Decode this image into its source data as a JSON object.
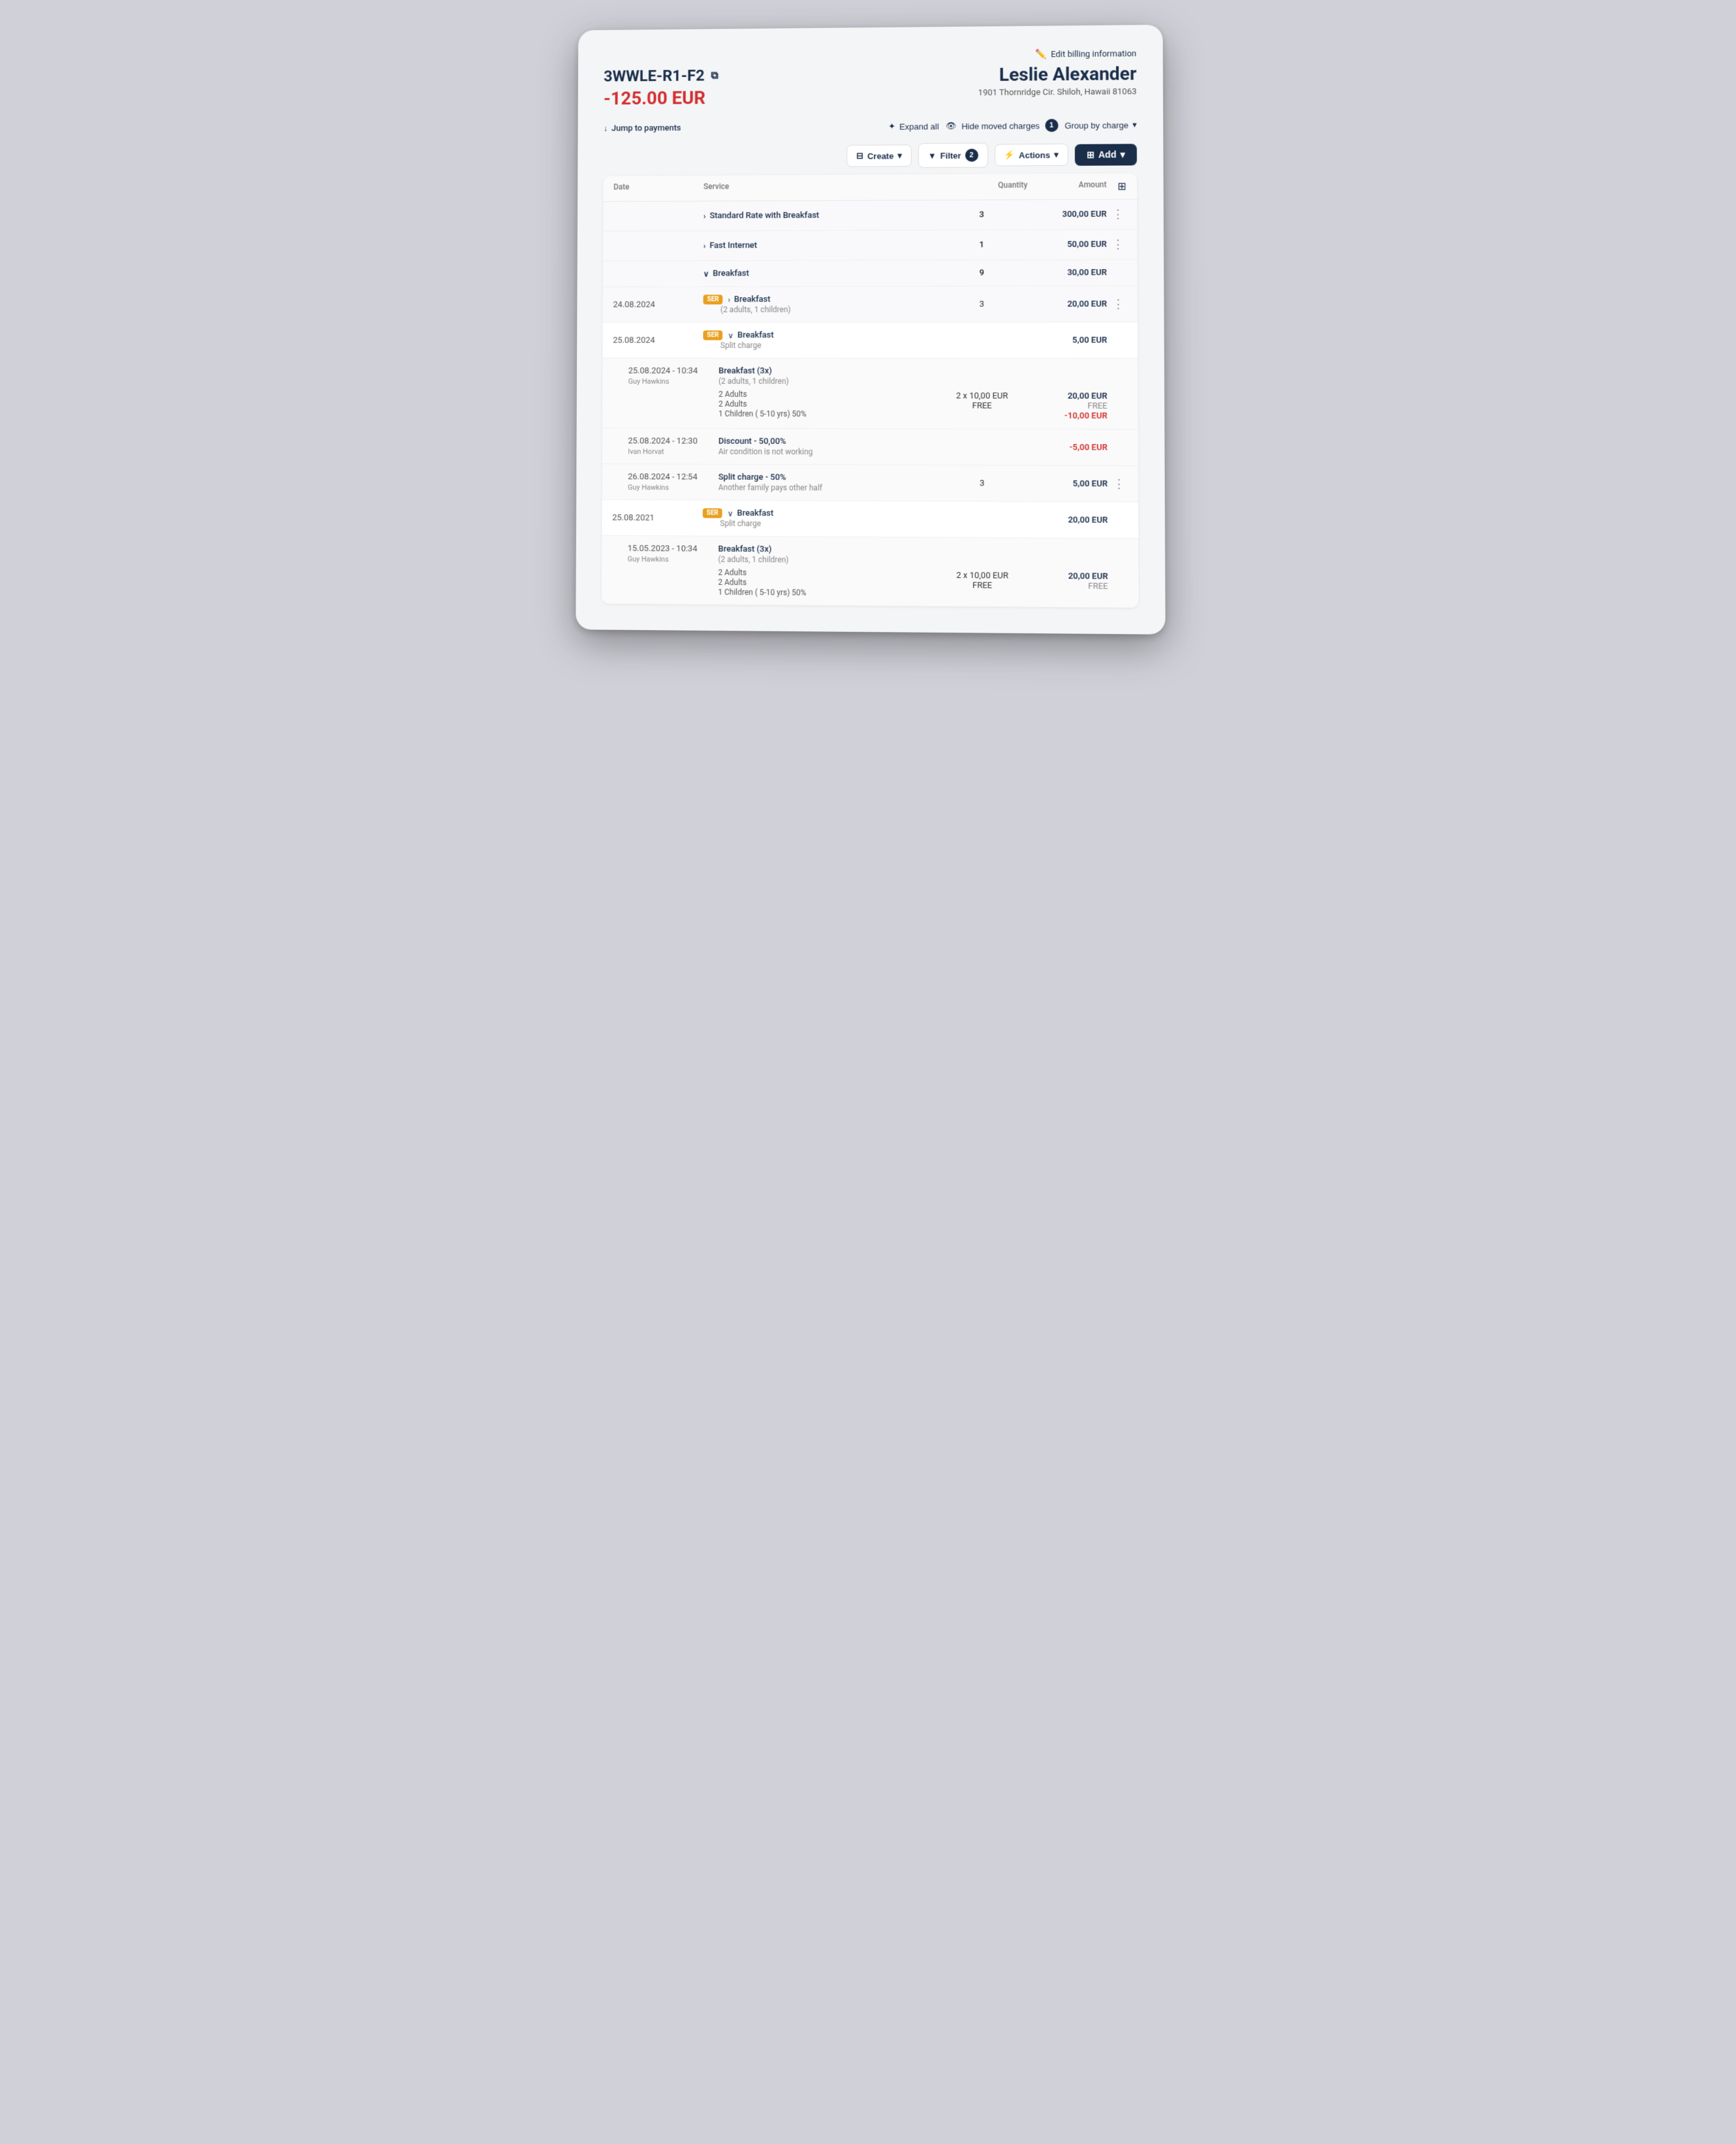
{
  "header": {
    "edit_billing_label": "Edit billing information",
    "folio_id": "3WWLE-R1-F2",
    "balance": "-125.00 EUR",
    "guest_name": "Leslie Alexander",
    "guest_address": "1901 Thornridge Cir. Shiloh, Hawaii 81063"
  },
  "toolbar": {
    "jump_label": "Jump to payments",
    "expand_label": "Expand all",
    "hide_moved_label": "Hide moved charges",
    "hide_moved_badge": "1",
    "group_by_label": "Group by charge",
    "filter_label": "Filter",
    "filter_badge": "2",
    "actions_label": "Actions",
    "add_label": "Add",
    "create_label": "Create"
  },
  "table": {
    "headers": {
      "date": "Date",
      "service": "Service",
      "quantity": "Quantity",
      "amount": "Amount"
    },
    "rows": [
      {
        "id": "row1",
        "type": "group-header",
        "date": "",
        "service": "Standard Rate with Breakfast",
        "service_secondary": "",
        "qty": "3",
        "amount": "300,00 EUR",
        "amount_type": "normal",
        "has_menu": true,
        "expanded": false
      },
      {
        "id": "row2",
        "type": "group-header",
        "date": "",
        "service": "Fast Internet",
        "service_secondary": "",
        "qty": "1",
        "amount": "50,00 EUR",
        "amount_type": "normal",
        "has_menu": false,
        "expanded": false
      },
      {
        "id": "row3",
        "type": "group-header-expanded",
        "date": "",
        "service": "Breakfast",
        "service_secondary": "",
        "qty": "9",
        "amount": "30,00 EUR",
        "amount_type": "normal",
        "has_menu": false,
        "expanded": true
      },
      {
        "id": "row4",
        "type": "sub-row",
        "date": "24.08.2024",
        "ser_badge": "SER",
        "service": "Breakfast",
        "service_secondary": "(2 adults, 1 children)",
        "qty": "3",
        "amount": "20,00 EUR",
        "amount_type": "normal",
        "has_menu": true,
        "expanded": false
      },
      {
        "id": "row5",
        "type": "sub-row-expanded",
        "date": "25.08.2024",
        "ser_badge": "SER",
        "service": "Breakfast",
        "service_secondary": "Split charge",
        "qty": "",
        "amount": "5,00 EUR",
        "amount_type": "normal",
        "has_menu": false,
        "expanded": true
      },
      {
        "id": "row6",
        "type": "detail",
        "date": "25.08.2024 - 10:34",
        "date_secondary": "Guy Hawkins",
        "service": "Breakfast (3x)",
        "service_secondary": "(2 adults, 1 children)",
        "detail_lines": [
          {
            "label": "2 Adults",
            "qty": "2 x 10,00 EUR",
            "amount": "20,00 EUR"
          },
          {
            "label": "2 Adults",
            "qty": "FREE",
            "amount": "FREE"
          },
          {
            "label": "1 Children ( 5-10 yrs) 50%",
            "qty": "",
            "amount": "-10,00 EUR"
          }
        ],
        "has_menu": false
      },
      {
        "id": "row7",
        "type": "detail-simple",
        "date": "25.08.2024 - 12:30",
        "date_secondary": "Ivan Horvat",
        "service": "Discount - 50,00%",
        "service_secondary": "Air condition is not working",
        "qty": "",
        "amount": "-5,00 EUR",
        "amount_type": "negative",
        "has_menu": false
      },
      {
        "id": "row8",
        "type": "detail-simple",
        "date": "26.08.2024 - 12:54",
        "date_secondary": "Guy Hawkins",
        "service": "Split charge - 50%",
        "service_secondary": "Another family pays other half",
        "qty": "3",
        "amount": "5,00 EUR",
        "amount_type": "normal",
        "has_menu": true
      },
      {
        "id": "row9",
        "type": "sub-row-expanded",
        "date": "25.08.2021",
        "ser_badge": "SER",
        "service": "Breakfast",
        "service_secondary": "Split charge",
        "qty": "",
        "amount": "20,00 EUR",
        "amount_type": "normal",
        "has_menu": false,
        "expanded": true
      },
      {
        "id": "row10",
        "type": "detail",
        "date": "15.05.2023 - 10:34",
        "date_secondary": "Guy Hawkins",
        "service": "Breakfast (3x)",
        "service_secondary": "(2 adults, 1 children)",
        "detail_lines": [
          {
            "label": "2 Adults",
            "qty": "2 x 10,00 EUR",
            "amount": "20,00 EUR"
          },
          {
            "label": "2 Adults",
            "qty": "FREE",
            "amount": "FREE"
          },
          {
            "label": "1 Children ( 5-10 yrs) 50%",
            "qty": "",
            "amount": ""
          }
        ],
        "has_menu": false
      }
    ]
  }
}
